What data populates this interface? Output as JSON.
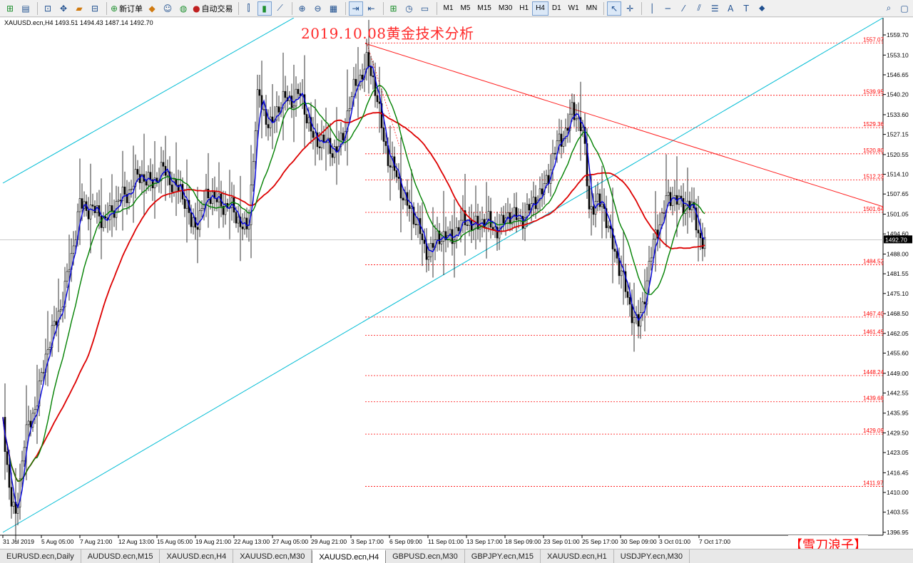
{
  "toolbar": {
    "new_order_label": "新订单",
    "autotrading_label": "自动交易",
    "timeframes": [
      "M1",
      "M5",
      "M15",
      "M30",
      "H1",
      "H4",
      "D1",
      "W1",
      "MN"
    ],
    "active_timeframe": "H4"
  },
  "chart": {
    "info": "XAUUSD.ecn,H4  1493.51 1494.43 1487.14 1492.70",
    "title": "2019.10.08黄金技术分析",
    "watermark": "【雪刀浪子】",
    "current_price": "1492.70",
    "price_axis": [
      "1559.70",
      "1553.10",
      "1546.65",
      "1540.20",
      "1533.60",
      "1527.15",
      "1520.55",
      "1514.10",
      "1507.65",
      "1501.05",
      "1494.60",
      "1488.00",
      "1481.55",
      "1475.10",
      "1468.50",
      "1462.05",
      "1455.60",
      "1449.00",
      "1442.55",
      "1435.95",
      "1429.50",
      "1423.05",
      "1416.45",
      "1410.00",
      "1403.55",
      "1396.95"
    ],
    "time_axis": [
      "31 Jul 2019",
      "5 Aug 05:00",
      "7 Aug 21:00",
      "12 Aug 13:00",
      "15 Aug 05:00",
      "19 Aug 21:00",
      "22 Aug 13:00",
      "27 Aug 05:00",
      "29 Aug 21:00",
      "3 Sep 17:00",
      "6 Sep 09:00",
      "11 Sep 01:00",
      "13 Sep 17:00",
      "18 Sep 09:00",
      "23 Sep 01:00",
      "25 Sep 17:00",
      "30 Sep 09:00",
      "3 Oct 01:00",
      "7 Oct 17:00"
    ],
    "level_labels": [
      "1557.07",
      "1539.95",
      "1529.36",
      "1520.80",
      "1512.23",
      "1501.64",
      "1484.52",
      "1467.40",
      "1461.45",
      "1448.24",
      "1439.68",
      "1429.09",
      "1411.97"
    ],
    "colors": {
      "candles": "#000000",
      "ma_fast": "#0000dd",
      "ma_mid": "#008000",
      "ma_slow": "#dd0000",
      "channel": "#00bcd4",
      "trendline": "#ff2020",
      "levels": "#ff0000"
    }
  },
  "tabs": [
    "EURUSD.ecn,Daily",
    "AUDUSD.ecn,M15",
    "XAUUSD.ecn,H4",
    "XAUUSD.ecn,M30",
    "XAUUSD.ecn,H4",
    "GBPUSD.ecn,M30",
    "GBPJPY.ecn,M15",
    "XAUUSD.ecn,H1",
    "USDJPY.ecn,M30"
  ],
  "active_tab_index": 4
}
